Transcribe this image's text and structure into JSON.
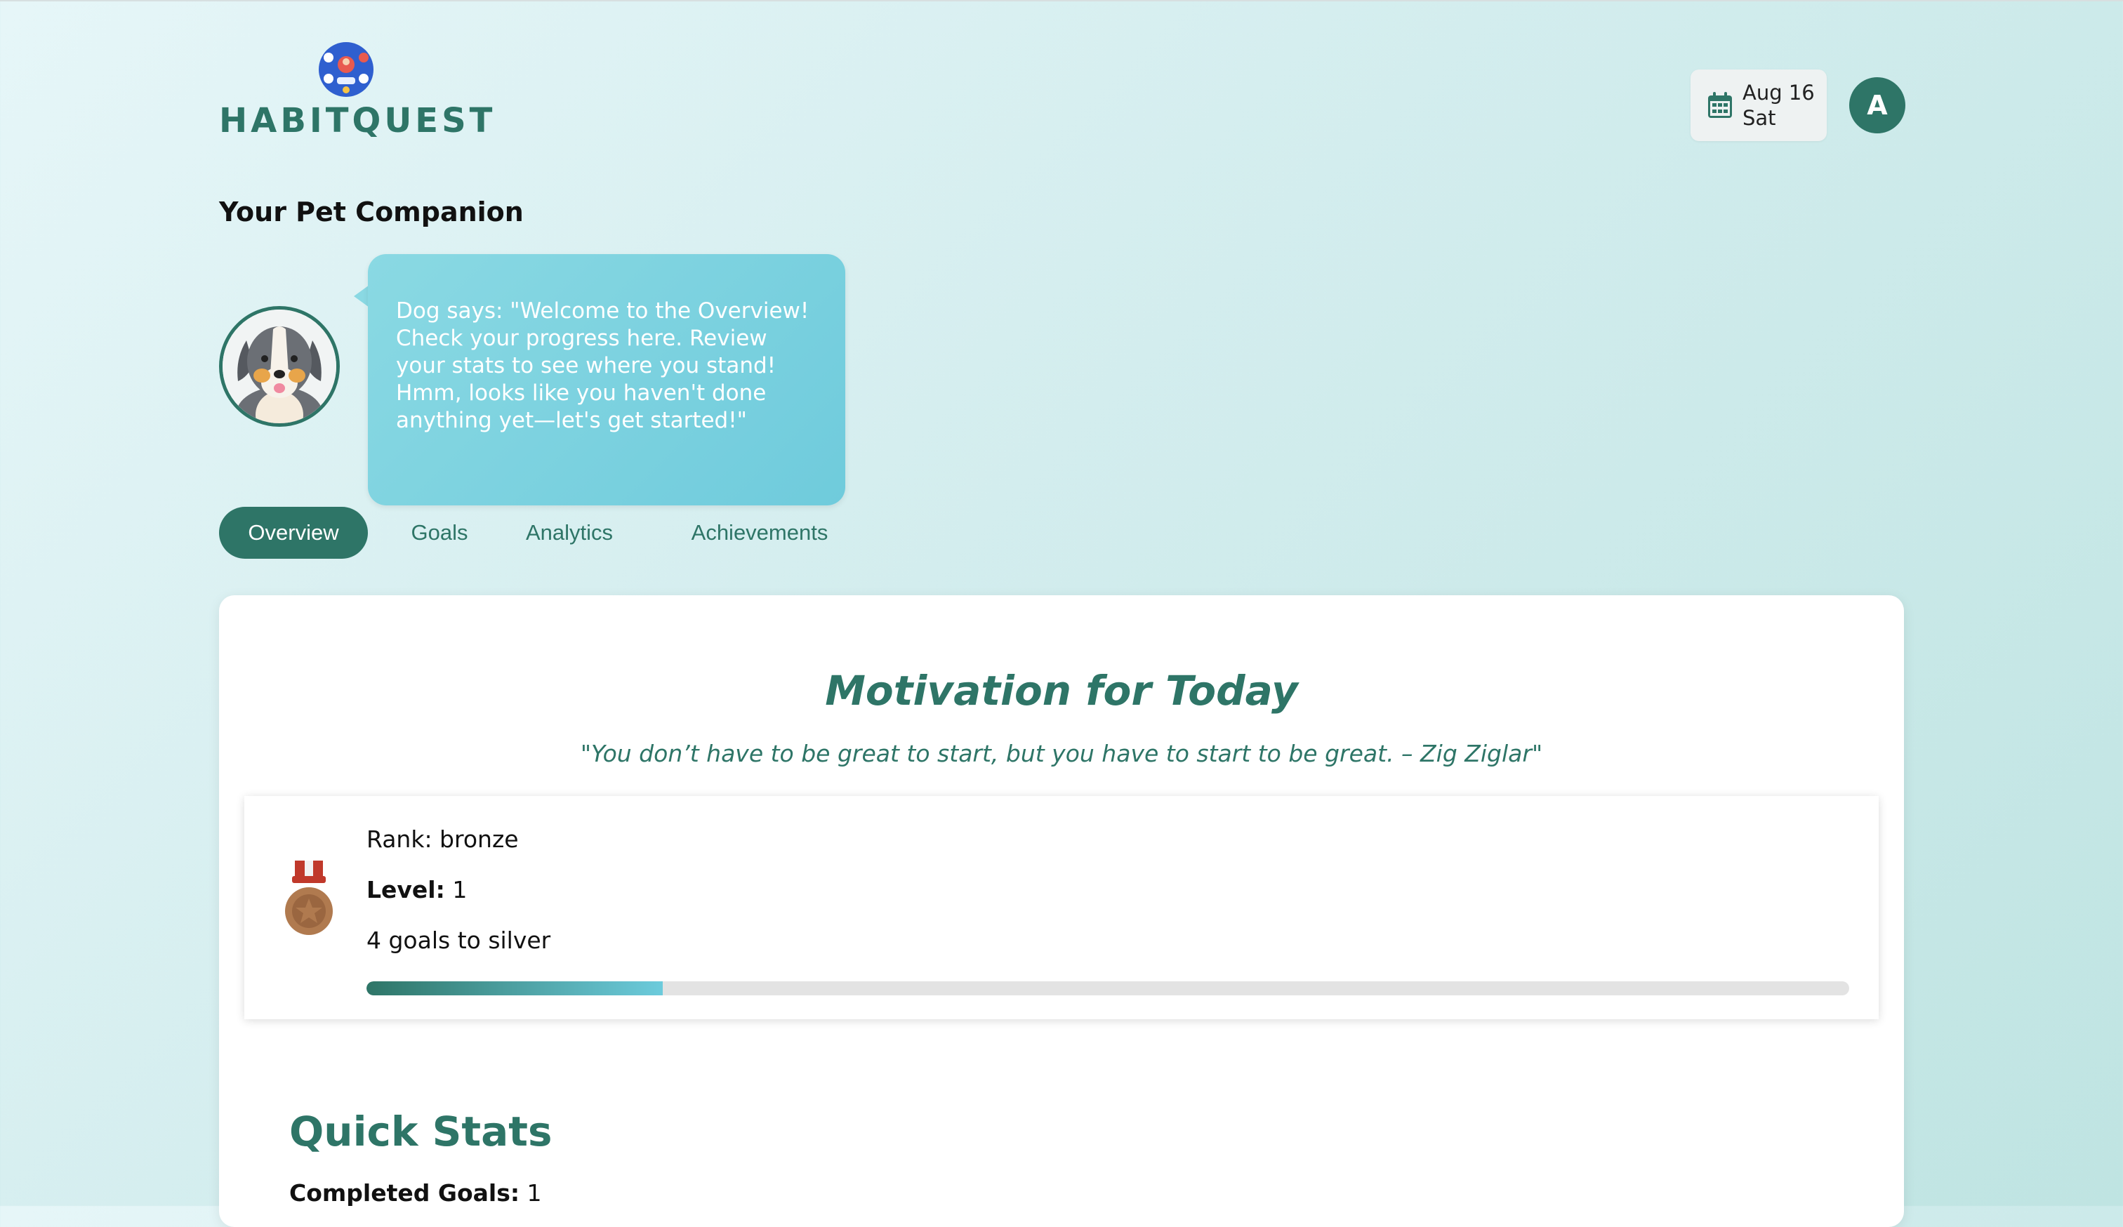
{
  "app": {
    "name": "HABITQUEST"
  },
  "header": {
    "date_line1": "Aug 16",
    "date_line2": "Sat",
    "avatar_initial": "A"
  },
  "pet": {
    "section_title": "Your Pet Companion",
    "message": "Dog says: \"Welcome to the Overview! Check your progress here. Review your stats to see where you stand! Hmm, looks like you haven't done anything yet—let's get started!\""
  },
  "tabs": [
    {
      "label": "Overview",
      "active": true
    },
    {
      "label": "Goals",
      "active": false
    },
    {
      "label": "Analytics",
      "active": false
    },
    {
      "label": "Achievements",
      "active": false
    }
  ],
  "motivation": {
    "title": "Motivation for Today",
    "quote": "\"You don’t have to be great to start, but you have to start to be great. – Zig Ziglar\""
  },
  "rank": {
    "rank_text": "Rank: bronze",
    "level_label": "Level:",
    "level_value": "1",
    "next_text": "4 goals to silver",
    "progress_fraction": 0.2
  },
  "quick_stats": {
    "title": "Quick Stats",
    "completed_label": "Completed Goals:",
    "completed_value": "1"
  },
  "colors": {
    "primary": "#2e7567",
    "bubble": "#7ccfdf",
    "progress_end": "#6ccbdc",
    "track": "#e3e3e3"
  }
}
